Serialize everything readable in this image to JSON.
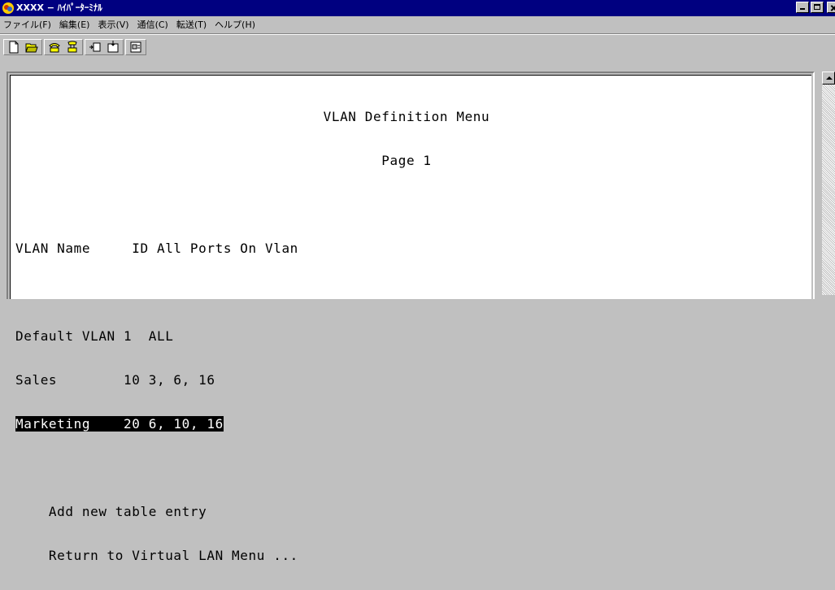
{
  "window": {
    "title": "XXXX − ﾊｲﾊﾟｰﾀｰﾐﾅﾙ",
    "icon": "hyperterminal-icon"
  },
  "menu": {
    "items": [
      "ファイル(F)",
      "編集(E)",
      "表示(V)",
      "通信(C)",
      "転送(T)",
      "ヘルプ(H)"
    ]
  },
  "toolbar": {
    "buttons": [
      "new-icon",
      "open-icon",
      "connect-icon",
      "disconnect-icon",
      "send-icon",
      "receive-icon",
      "properties-icon"
    ]
  },
  "terminal": {
    "lines": [
      "                                     VLAN Definition Menu",
      "                                            Page 1",
      "",
      "VLAN Name     ID All Ports On Vlan",
      "",
      "Default VLAN 1  ALL",
      "Sales        10 3, 6, 16",
      "Marketing    20 6, 10, 16",
      "",
      "    Add new table entry",
      "    Return to Virtual LAN Menu ..."
    ],
    "selected_line": "Marketing    20 6, 10, 16"
  },
  "colors": {
    "titlebar": "#000080",
    "chrome": "#c0c0c0",
    "terminal_bg": "#ffffff",
    "highlight_bg": "#000000"
  }
}
